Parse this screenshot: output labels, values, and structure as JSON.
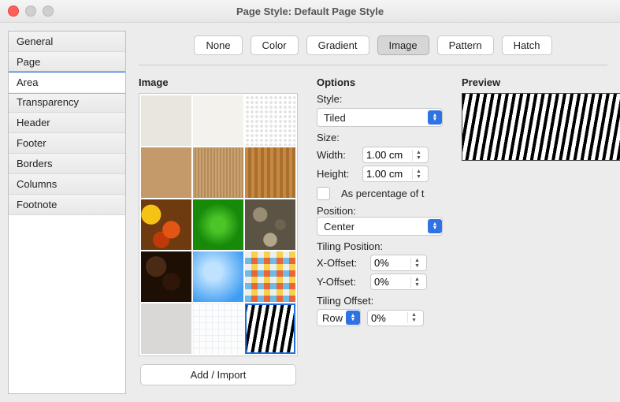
{
  "window": {
    "title": "Page Style: Default Page Style"
  },
  "sidebar": {
    "items": [
      {
        "label": "General"
      },
      {
        "label": "Page"
      },
      {
        "label": "Area",
        "selected": true
      },
      {
        "label": "Transparency"
      },
      {
        "label": "Header"
      },
      {
        "label": "Footer"
      },
      {
        "label": "Borders"
      },
      {
        "label": "Columns"
      },
      {
        "label": "Footnote"
      }
    ]
  },
  "tabs": [
    {
      "label": "None"
    },
    {
      "label": "Color"
    },
    {
      "label": "Gradient"
    },
    {
      "label": "Image",
      "active": true
    },
    {
      "label": "Pattern"
    },
    {
      "label": "Hatch"
    }
  ],
  "image_section": {
    "title": "Image",
    "swatches": [
      {
        "name": "paper-texture"
      },
      {
        "name": "white-paper"
      },
      {
        "name": "crumpled-paper"
      },
      {
        "name": "kraft"
      },
      {
        "name": "cardboard"
      },
      {
        "name": "corrugated"
      },
      {
        "name": "autumn-leaves"
      },
      {
        "name": "grass"
      },
      {
        "name": "pebbles"
      },
      {
        "name": "coffee-beans"
      },
      {
        "name": "sky"
      },
      {
        "name": "mosaic"
      },
      {
        "name": "concrete"
      },
      {
        "name": "graph-paper"
      },
      {
        "name": "zebra",
        "selected": true
      }
    ],
    "add_button": "Add / Import"
  },
  "options": {
    "title": "Options",
    "style_label": "Style:",
    "style_value": "Tiled",
    "size_label": "Size:",
    "width_label": "Width:",
    "width_value": "1.00 cm",
    "height_label": "Height:",
    "height_value": "1.00 cm",
    "percent_label": "As percentage of t",
    "percent_checked": false,
    "position_label": "Position:",
    "position_value": "Center",
    "tiling_position_label": "Tiling Position:",
    "xoff_label": "X-Offset:",
    "xoff_value": "0%",
    "yoff_label": "Y-Offset:",
    "yoff_value": "0%",
    "tiling_offset_label": "Tiling Offset:",
    "tiling_offset_axis": "Row",
    "tiling_offset_value": "0%"
  },
  "preview": {
    "title": "Preview"
  }
}
